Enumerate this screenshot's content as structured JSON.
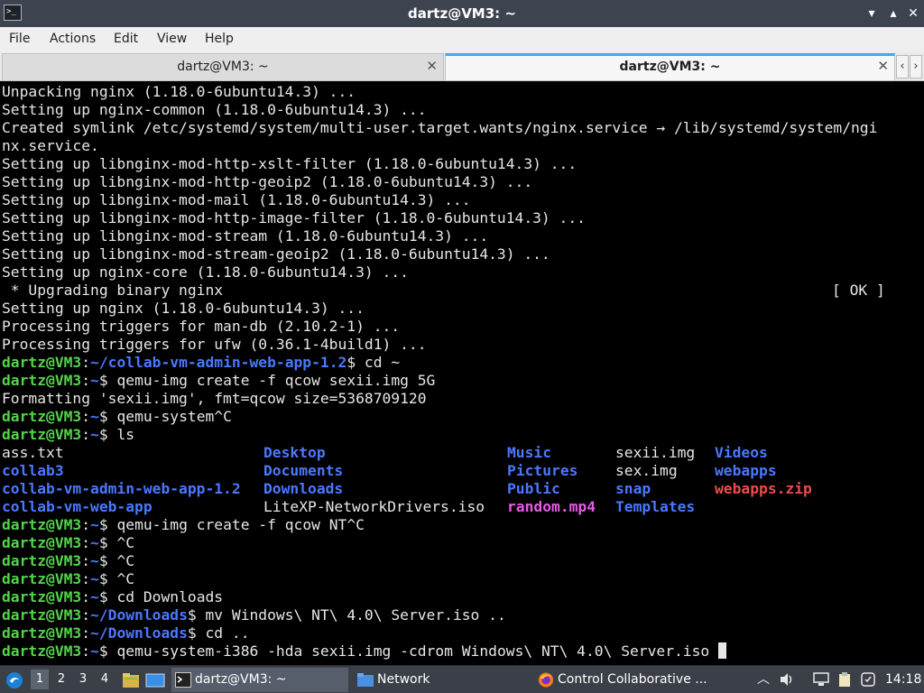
{
  "window": {
    "title": "dartz@VM3: ~",
    "app_icon": "terminal-icon",
    "icon_text": ">_"
  },
  "menu": [
    "File",
    "Actions",
    "Edit",
    "View",
    "Help"
  ],
  "tabs": [
    {
      "label": "dartz@VM3: ~",
      "active": false
    },
    {
      "label": "dartz@VM3: ~",
      "active": true
    }
  ],
  "terminal": {
    "lines": [
      "Unpacking nginx (1.18.0-6ubuntu14.3) ...",
      "Setting up nginx-common (1.18.0-6ubuntu14.3) ...",
      "Created symlink /etc/systemd/system/multi-user.target.wants/nginx.service → /lib/systemd/system/ngi",
      "nx.service.",
      "Setting up libnginx-mod-http-xslt-filter (1.18.0-6ubuntu14.3) ...",
      "Setting up libnginx-mod-http-geoip2 (1.18.0-6ubuntu14.3) ...",
      "Setting up libnginx-mod-mail (1.18.0-6ubuntu14.3) ...",
      "Setting up libnginx-mod-http-image-filter (1.18.0-6ubuntu14.3) ...",
      "Setting up libnginx-mod-stream (1.18.0-6ubuntu14.3) ...",
      "Setting up libnginx-mod-stream-geoip2 (1.18.0-6ubuntu14.3) ...",
      "Setting up nginx-core (1.18.0-6ubuntu14.3) ...",
      " * Upgrading binary nginx",
      "Setting up nginx (1.18.0-6ubuntu14.3) ...",
      "Processing triggers for man-db (2.10.2-1) ...",
      "Processing triggers for ufw (0.36.1-4build1) ..."
    ],
    "ok_marker": "[ OK ]",
    "prompt_user": "dartz@VM3",
    "session": [
      {
        "path": "~/collab-vm-admin-web-app-1.2",
        "cmd": " cd ~"
      },
      {
        "path": "~",
        "cmd": " qemu-img create -f qcow sexii.img 5G"
      },
      {
        "output": "Formatting 'sexii.img', fmt=qcow size=5368709120"
      },
      {
        "path": "~",
        "cmd": " qemu-system^C"
      },
      {
        "path": "~",
        "cmd": " ls"
      }
    ],
    "ls": [
      [
        {
          "name": "ass.txt",
          "type": "file"
        },
        {
          "name": "collab3",
          "type": "dir"
        },
        {
          "name": "collab-vm-admin-web-app-1.2",
          "type": "dir"
        },
        {
          "name": "collab-vm-web-app",
          "type": "dir"
        }
      ],
      [
        {
          "name": "Desktop",
          "type": "dir"
        },
        {
          "name": "Documents",
          "type": "dir"
        },
        {
          "name": "Downloads",
          "type": "dir"
        },
        {
          "name": "LiteXP-NetworkDrivers.iso",
          "type": "file"
        }
      ],
      [
        {
          "name": "Music",
          "type": "dir"
        },
        {
          "name": "Pictures",
          "type": "dir"
        },
        {
          "name": "Public",
          "type": "dir"
        },
        {
          "name": "random.mp4",
          "type": "media"
        }
      ],
      [
        {
          "name": "sexii.img",
          "type": "file"
        },
        {
          "name": "sex.img",
          "type": "file"
        },
        {
          "name": "snap",
          "type": "dir"
        },
        {
          "name": "Templates",
          "type": "dir"
        }
      ],
      [
        {
          "name": "Videos",
          "type": "dir"
        },
        {
          "name": "webapps",
          "type": "dir"
        },
        {
          "name": "webapps.zip",
          "type": "archive"
        },
        {
          "name": "",
          "type": "file"
        }
      ]
    ],
    "session2": [
      {
        "path": "~",
        "cmd": " qemu-img create -f qcow NT^C"
      },
      {
        "path": "~",
        "cmd": " ^C"
      },
      {
        "path": "~",
        "cmd": " ^C"
      },
      {
        "path": "~",
        "cmd": " ^C"
      },
      {
        "path": "~",
        "cmd": " cd Downloads"
      },
      {
        "path": "~/Downloads",
        "cmd": " mv Windows\\ NT\\ 4.0\\ Server.iso .."
      },
      {
        "path": "~/Downloads",
        "cmd": " cd .."
      },
      {
        "path": "~",
        "cmd": " qemu-system-i386 -hda sexii.img -cdrom Windows\\ NT\\ 4.0\\ Server.iso ",
        "cursor": true
      }
    ]
  },
  "taskbar": {
    "workspaces": [
      "1",
      "2",
      "3",
      "4"
    ],
    "active_workspace": "1",
    "tasks": [
      {
        "label": "dartz@VM3: ~",
        "icon": "terminal-icon",
        "active": true
      },
      {
        "label": "Network",
        "icon": "folder-icon",
        "active": false
      },
      {
        "label": "Control Collaborative ...",
        "icon": "firefox-icon",
        "active": false
      }
    ],
    "clock": "14:18"
  },
  "colors": {
    "prompt_user": "#54d34a",
    "prompt_path": "#4a78ff",
    "dir": "#4a78ff",
    "media": "#e75ae6",
    "archive": "#ef4b4b",
    "terminal_bg": "#000000",
    "accent": "#3daee9"
  }
}
